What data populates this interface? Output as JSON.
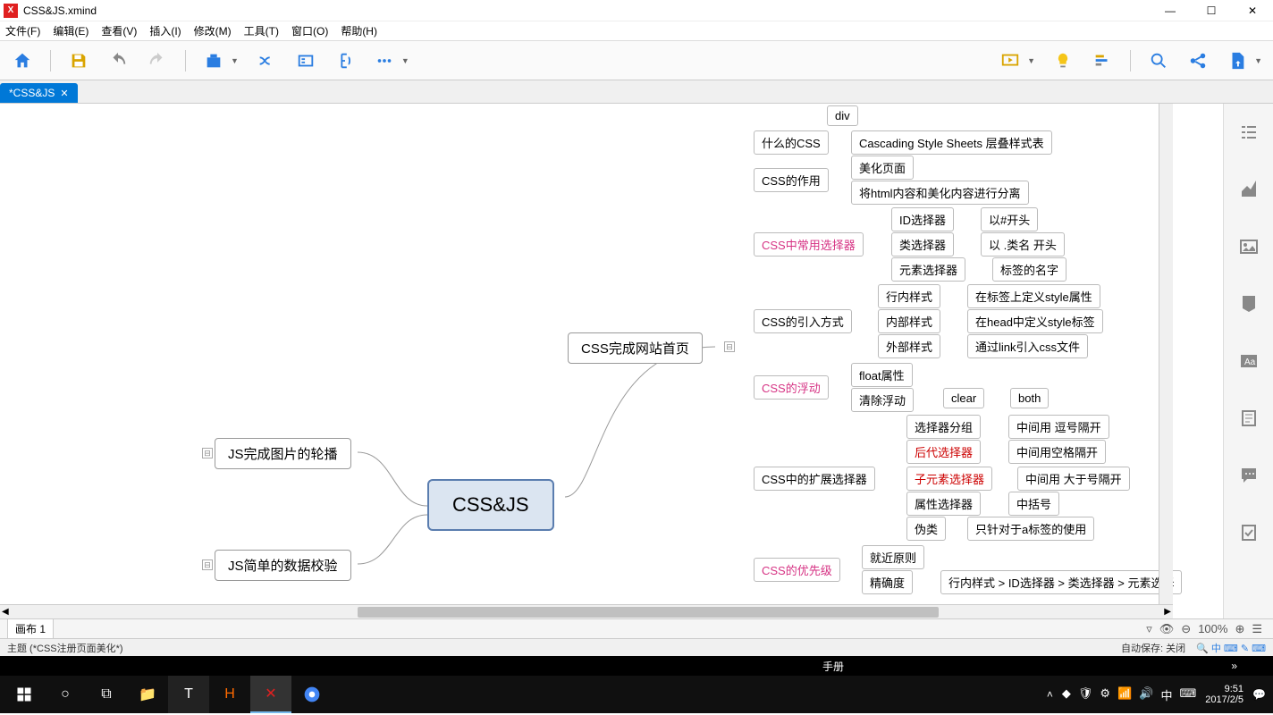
{
  "window": {
    "title": "CSS&JS.xmind",
    "min": "—",
    "max": "☐",
    "close": "✕"
  },
  "menu": {
    "file": "文件(F)",
    "edit": "编辑(E)",
    "view": "查看(V)",
    "insert": "插入(I)",
    "modify": "修改(M)",
    "tools": "工具(T)",
    "window": "窗口(O)",
    "help": "帮助(H)"
  },
  "tab": {
    "label": "*CSS&JS",
    "close": "✕"
  },
  "mindmap": {
    "central": "CSS&JS",
    "left1": "JS完成图片的轮播",
    "left2": "JS简单的数据校验",
    "right1": "CSS完成网站首页",
    "branches": {
      "b1": {
        "label": "什么的CSS",
        "c1": "div",
        "c2": "Cascading Style Sheets 层叠样式表"
      },
      "b2": {
        "label": "CSS的作用",
        "c1": "美化页面",
        "c2": "将html内容和美化内容进行分离"
      },
      "b3": {
        "label": "CSS中常用选择器",
        "c1": "ID选择器",
        "c1b": "以#开头",
        "c2": "类选择器",
        "c2b": "以 .类名 开头",
        "c3": "元素选择器",
        "c3b": "标签的名字"
      },
      "b4": {
        "label": "CSS的引入方式",
        "c1": "行内样式",
        "c1b": "在标签上定义style属性",
        "c2": "内部样式",
        "c2b": "在head中定义style标签",
        "c3": "外部样式",
        "c3b": "通过link引入css文件"
      },
      "b5": {
        "label": "CSS的浮动",
        "c1": "float属性",
        "c2": "清除浮动",
        "c2b": "clear",
        "c2c": "both"
      },
      "b6": {
        "label": "CSS中的扩展选择器",
        "c1": "选择器分组",
        "c1b": "中间用 逗号隔开",
        "c2": "后代选择器",
        "c2b": "中间用空格隔开",
        "c3": "子元素选择器",
        "c3b": "中间用 大于号隔开",
        "c4": "属性选择器",
        "c4b": "中括号",
        "c5": "伪类",
        "c5b": "只针对于a标签的使用"
      },
      "b7": {
        "label": "CSS的优先级",
        "c1": "就近原则",
        "c2": "精确度",
        "c2b": "行内样式 > ID选择器 > 类选择器 > 元素选择"
      }
    }
  },
  "bottom": {
    "sheet": "画布 1",
    "zoom": "100%"
  },
  "status": {
    "topic": "主题 (*CSS注册页面美化*)",
    "autosave": "自动保存: 关闭"
  },
  "taskcontext": {
    "manual": "手册"
  },
  "taskbar": {
    "time": "9:51",
    "date": "2017/2/5",
    "ime": "中"
  }
}
